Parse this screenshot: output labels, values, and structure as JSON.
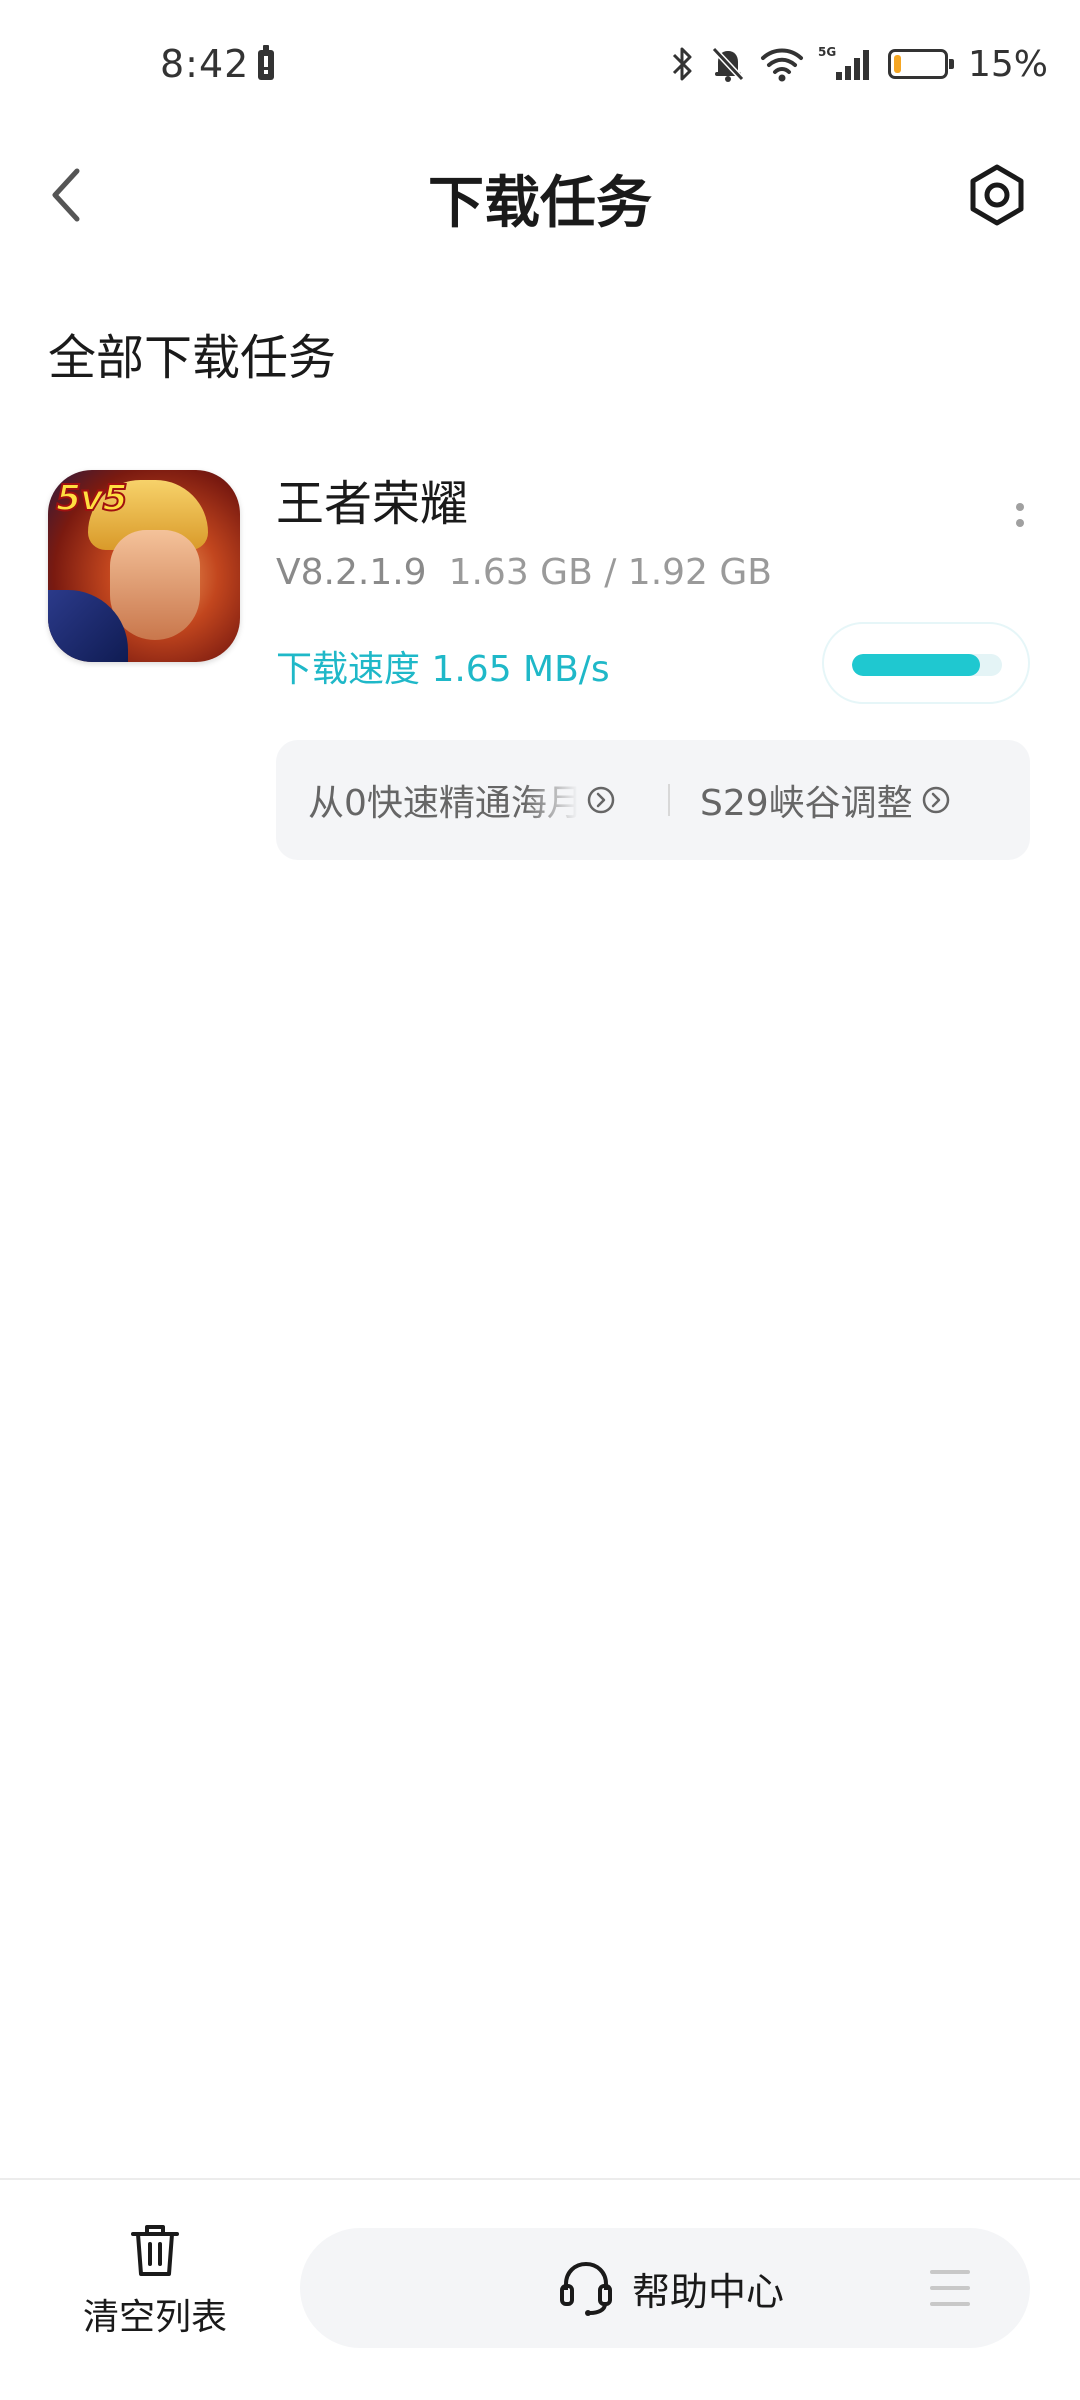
{
  "status_bar": {
    "time": "8:42",
    "battery_percent": "15%",
    "battery_level": 0.15,
    "icons": [
      "bluetooth-icon",
      "mute-bell-icon",
      "wifi-icon",
      "5g-signal-icon",
      "battery-icon"
    ],
    "network_label": "5G"
  },
  "header": {
    "title": "下载任务",
    "back_icon": "chevron-left-icon",
    "settings_icon": "settings-hexagon-icon"
  },
  "section": {
    "title": "全部下载任务"
  },
  "task": {
    "app_name": "王者荣耀",
    "icon_badge": "5v5",
    "version": "V8.2.1.9",
    "size_progress": "1.63 GB / 1.92 GB",
    "speed": "下载速度 1.65 MB/s",
    "progress_fraction": 0.85,
    "links": [
      {
        "label": "从0快速精通海月",
        "icon": "circle-chevron-right-icon"
      },
      {
        "label": "S29峡谷调整",
        "icon": "circle-chevron-right-icon"
      }
    ]
  },
  "bottom_bar": {
    "clear_label": "清空列表",
    "clear_icon": "trash-icon",
    "help_label": "帮助中心",
    "help_icon": "headset-icon",
    "menu_icon": "menu-icon"
  },
  "colors": {
    "accent": "#1fb8c8",
    "progress_fill": "#1fc8d0",
    "battery": "#f5a623"
  }
}
